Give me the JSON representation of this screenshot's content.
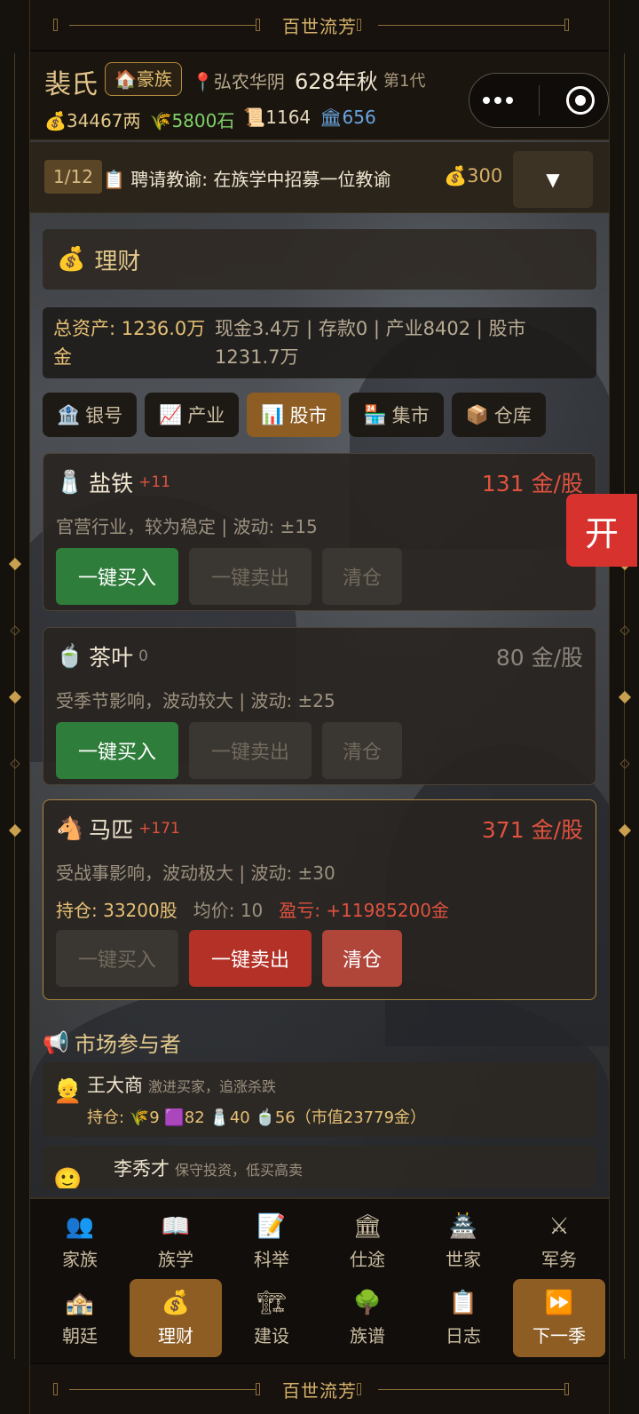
{
  "banner": {
    "title": "百世流芳"
  },
  "header": {
    "clan_name": "裴氏",
    "rank_tag": "豪族",
    "location": "弘农华阴",
    "date": "628年秋",
    "generation": "第1代",
    "resources": {
      "money": "34467两",
      "grain": "5800石",
      "books": "1164",
      "influence": "656"
    }
  },
  "task": {
    "progress": "1/12",
    "text": "聘请教谕: 在族学中招募一位教谕",
    "cost": "300",
    "drop_icon": "▼"
  },
  "section": {
    "title": "理财"
  },
  "assets": {
    "total": "总资产: 1236.0万金",
    "breakdown": "现金3.4万 | 存款0 | 产业8402 | 股市1231.7万"
  },
  "tabs": [
    {
      "label": "银号",
      "icon": "bank-icon"
    },
    {
      "label": "产业",
      "icon": "chart-up-icon"
    },
    {
      "label": "股市",
      "icon": "bar-chart-icon",
      "active": true
    },
    {
      "label": "集市",
      "icon": "market-icon"
    },
    {
      "label": "仓库",
      "icon": "box-icon"
    }
  ],
  "stocks": [
    {
      "name": "盐铁",
      "change": "+11",
      "price": "131 金/股",
      "desc": "官营行业，较为稳定 | 波动: ±15",
      "buy": "一键买入",
      "sell": "一键卖出",
      "clear": "清仓"
    },
    {
      "name": "茶叶",
      "change": "0",
      "price": "80 金/股",
      "desc": "受季节影响，波动较大 | 波动: ±25",
      "buy": "一键买入",
      "sell": "一键卖出",
      "clear": "清仓"
    },
    {
      "name": "马匹",
      "change": "+171",
      "price": "371 金/股",
      "desc": "受战事影响，波动极大 | 波动: ±30",
      "holding": "持仓: 33200股",
      "avg": "均价: 10",
      "pnl": "盈亏: +11985200金",
      "buy": "一键买入",
      "sell": "一键卖出",
      "clear": "清仓"
    }
  ],
  "open_button": "开",
  "market": {
    "title": "市场参与者",
    "participants": [
      {
        "name": "王大商",
        "style": "激进买家，追涨杀跌",
        "holdings": "持仓: 🌾9 🟪82 🧂40 🍵56（市值23779金）"
      },
      {
        "name": "李秀才",
        "style": "保守投资，低买高卖"
      }
    ]
  },
  "nav": {
    "row1": [
      {
        "label": "家族",
        "icon": "family-icon"
      },
      {
        "label": "族学",
        "icon": "book-icon"
      },
      {
        "label": "科举",
        "icon": "memo-icon"
      },
      {
        "label": "仕途",
        "icon": "pillar-icon"
      },
      {
        "label": "世家",
        "icon": "castle-icon"
      },
      {
        "label": "军务",
        "icon": "swords-icon"
      }
    ],
    "row2": [
      {
        "label": "朝廷",
        "icon": "palace-icon"
      },
      {
        "label": "理财",
        "icon": "money-bag-icon",
        "active": true
      },
      {
        "label": "建设",
        "icon": "construction-icon"
      },
      {
        "label": "族谱",
        "icon": "tree-icon"
      },
      {
        "label": "日志",
        "icon": "clipboard-icon"
      },
      {
        "label": "下一季",
        "icon": "fast-forward-icon"
      }
    ]
  },
  "colors": {
    "accent": "#8d5d24",
    "gold": "#e6c074",
    "red": "#e0523f",
    "green": "#2f7d3b"
  }
}
